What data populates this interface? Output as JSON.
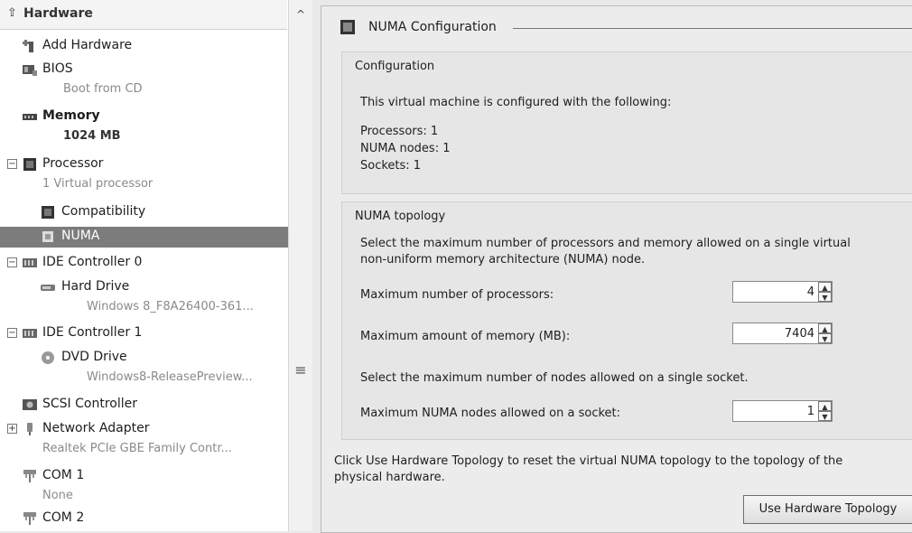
{
  "tree": {
    "header": "Hardware",
    "items": [
      {
        "label": "Add Hardware"
      },
      {
        "label": "BIOS",
        "sub": "Boot from CD"
      },
      {
        "label": "Memory",
        "sub": "1024 MB"
      },
      {
        "label": "Processor",
        "sub": "1 Virtual processor",
        "expander": "−"
      },
      {
        "label": "Compatibility"
      },
      {
        "label": "NUMA"
      },
      {
        "label": "IDE Controller 0",
        "expander": "−"
      },
      {
        "label": "Hard Drive",
        "sub": "Windows 8_F8A26400-361..."
      },
      {
        "label": "IDE Controller 1",
        "expander": "−"
      },
      {
        "label": "DVD Drive",
        "sub": "Windows8-ReleasePreview..."
      },
      {
        "label": "SCSI Controller"
      },
      {
        "label": "Network Adapter",
        "sub": "Realtek PCIe GBE Family Contr...",
        "expander": "+"
      },
      {
        "label": "COM 1",
        "sub": "None"
      },
      {
        "label": "COM 2"
      }
    ],
    "scroll_up": "^",
    "scroll_grip": "≡"
  },
  "panel": {
    "title": "NUMA Configuration",
    "configuration": {
      "heading": "Configuration",
      "intro": "This virtual machine is configured with the following:",
      "processors": "Processors: 1",
      "numa_nodes": "NUMA nodes: 1",
      "sockets": "Sockets: 1"
    },
    "topology": {
      "heading": "NUMA topology",
      "desc_line1": "Select the maximum number of processors and memory allowed on a single virtual",
      "desc_line2": "non-uniform memory architecture (NUMA) node.",
      "max_processors_label": "Maximum number of processors:",
      "max_processors_value": "4",
      "max_memory_label": "Maximum amount of memory (MB):",
      "max_memory_value": "7404",
      "nodes_desc": "Select the maximum number of nodes allowed on a single socket.",
      "max_nodes_label": "Maximum NUMA nodes allowed on a socket:",
      "max_nodes_value": "1"
    },
    "reset_line1": "Click Use Hardware Topology to reset the virtual NUMA topology to the topology of the",
    "reset_line2": "physical hardware.",
    "button_label": "Use Hardware Topology"
  }
}
